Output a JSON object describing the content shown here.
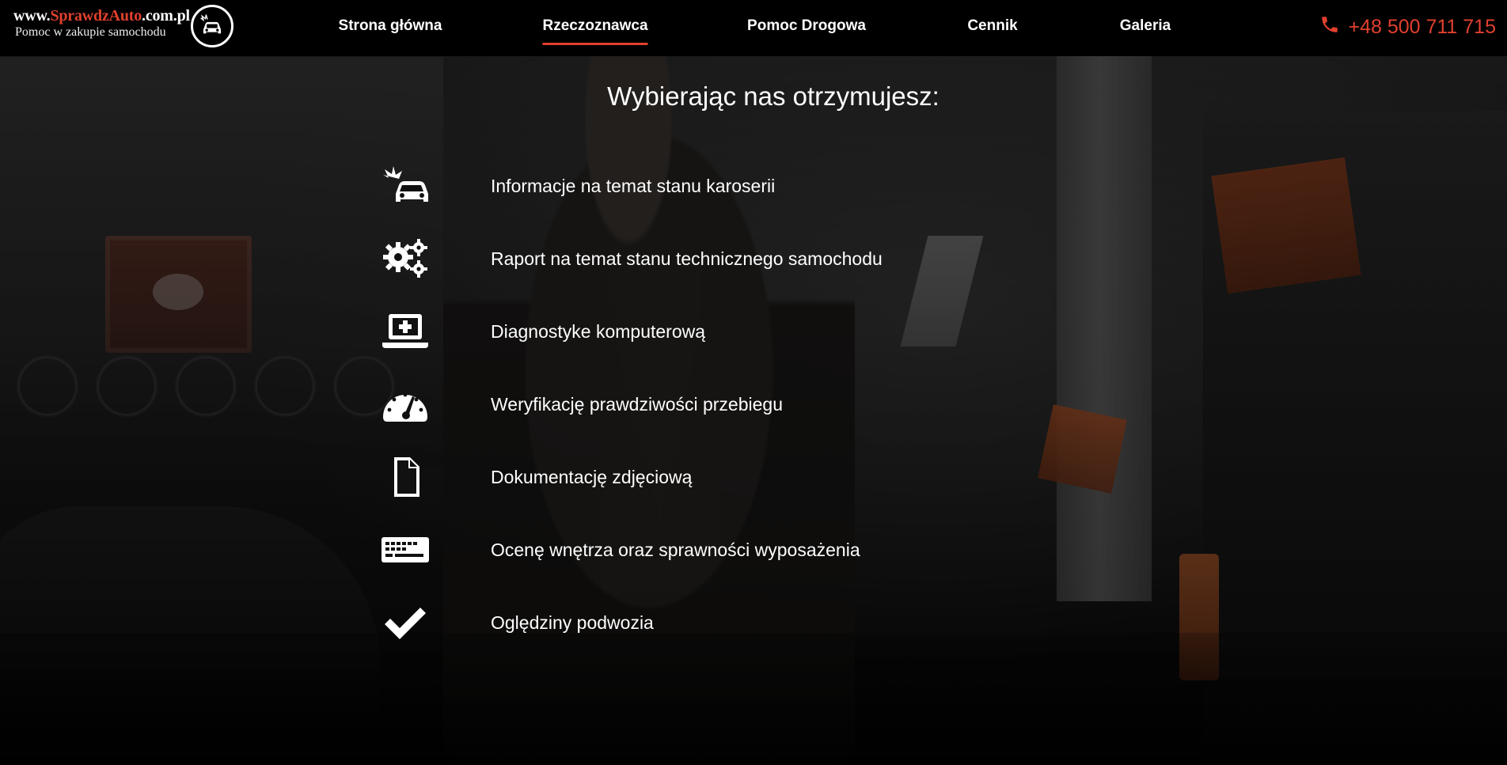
{
  "brand": {
    "domain_prefix": "www.",
    "domain_highlight": "SprawdzAuto",
    "domain_suffix": ".com.pl",
    "tagline": "Pomoc w zakupie samochodu",
    "logo_icon": "car-crash-icon"
  },
  "nav": {
    "items": [
      {
        "label": "Strona główna",
        "active": false
      },
      {
        "label": "Rzeczoznawca",
        "active": true
      },
      {
        "label": "Pomoc Drogowa",
        "active": false
      },
      {
        "label": "Cennik",
        "active": false
      },
      {
        "label": "Galeria",
        "active": false
      }
    ]
  },
  "contact": {
    "phone": "+48 500 711 715",
    "icon": "phone-icon"
  },
  "main": {
    "heading": "Wybierając nas otrzymujesz:",
    "features": [
      {
        "icon": "car-crash-icon",
        "text": "Informacje na temat stanu karoserii"
      },
      {
        "icon": "gears-icon",
        "text": "Raport na temat stanu technicznego samochodu"
      },
      {
        "icon": "laptop-medical-icon",
        "text": "Diagnostyke komputerową"
      },
      {
        "icon": "speedometer-icon",
        "text": "Weryfikację prawdziwości przebiegu"
      },
      {
        "icon": "file-icon",
        "text": "Dokumentację zdjęciową"
      },
      {
        "icon": "keyboard-icon",
        "text": "Ocenę wnętrza oraz sprawności wyposażenia"
      },
      {
        "icon": "check-icon",
        "text": "Oględziny podwozia"
      }
    ]
  },
  "colors": {
    "accent": "#e0402e",
    "header_bg": "#000000",
    "text": "#ffffff"
  }
}
